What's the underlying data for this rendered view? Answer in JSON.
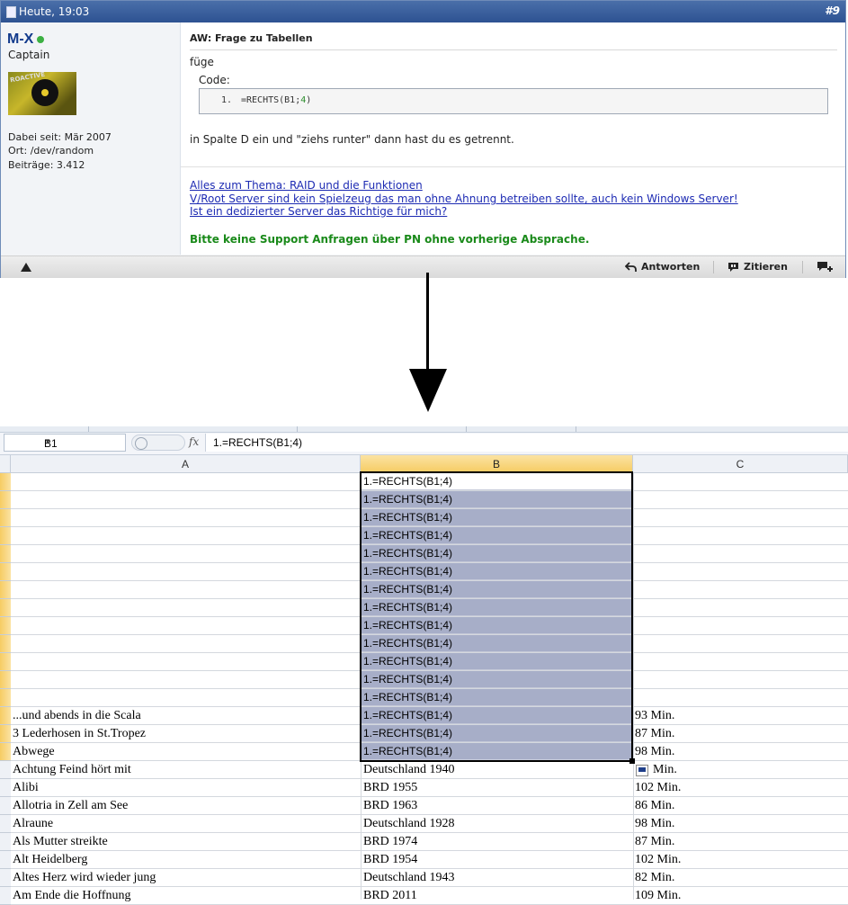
{
  "post": {
    "header": {
      "date": "Heute, 19:03",
      "number": "#9"
    },
    "user": {
      "name": "M-X",
      "rank": "Captain",
      "avatar_text": "ROACTIVE",
      "info": [
        "Dabei seit: Mär 2007",
        "Ort: /dev/random",
        "Beiträge: 3.412"
      ]
    },
    "title": "AW: Frage zu Tabellen",
    "intro": "füge",
    "code": {
      "label": "Code:",
      "line_no": "1.",
      "line_pre": "=RECHTS(B1;",
      "line_num": "4",
      "line_post": ")"
    },
    "after": "in Spalte D ein und \"ziehs runter\" dann hast du es getrennt.",
    "signature": {
      "links": [
        "Alles zum Thema: RAID und die Funktionen",
        "V/Root Server sind kein Spielzeug das man ohne Ahnung betreiben sollte, auch kein Windows Server!",
        "Ist ein dedizierter Server das Richtige für mich?"
      ],
      "note": "Bitte keine Support Anfragen über PN ohne vorherige Absprache."
    },
    "toolbar": {
      "reply": "Antworten",
      "quote": "Zitieren"
    }
  },
  "sheet": {
    "name_box": "B1",
    "fx": "fx",
    "formula": "1.=RECHTS(B1;4)",
    "columns": [
      "A",
      "B",
      "C"
    ],
    "selected_value": "1.=RECHTS(B1;4)",
    "rows": [
      {
        "a": "",
        "b": "1.=RECHTS(B1;4)",
        "c": ""
      },
      {
        "a": "",
        "b": "1.=RECHTS(B1;4)",
        "c": ""
      },
      {
        "a": "",
        "b": "1.=RECHTS(B1;4)",
        "c": ""
      },
      {
        "a": "",
        "b": "1.=RECHTS(B1;4)",
        "c": ""
      },
      {
        "a": "",
        "b": "1.=RECHTS(B1;4)",
        "c": ""
      },
      {
        "a": "",
        "b": "1.=RECHTS(B1;4)",
        "c": ""
      },
      {
        "a": "",
        "b": "1.=RECHTS(B1;4)",
        "c": ""
      },
      {
        "a": "",
        "b": "1.=RECHTS(B1;4)",
        "c": ""
      },
      {
        "a": "",
        "b": "1.=RECHTS(B1;4)",
        "c": ""
      },
      {
        "a": "",
        "b": "1.=RECHTS(B1;4)",
        "c": ""
      },
      {
        "a": "",
        "b": "1.=RECHTS(B1;4)",
        "c": ""
      },
      {
        "a": "",
        "b": "1.=RECHTS(B1;4)",
        "c": ""
      },
      {
        "a": "",
        "b": "1.=RECHTS(B1;4)",
        "c": ""
      },
      {
        "a": "...und abends in die Scala",
        "b": "1.=RECHTS(B1;4)",
        "c": "93 Min."
      },
      {
        "a": "3 Lederhosen in St.Tropez",
        "b": "1.=RECHTS(B1;4)",
        "c": "87 Min."
      },
      {
        "a": "Abwege",
        "b": "1.=RECHTS(B1;4)",
        "c": "98 Min."
      },
      {
        "a": "Achtung Feind hört mit",
        "b": "Deutschland 1940",
        "c": "Min."
      },
      {
        "a": "Alibi",
        "b": "BRD 1955",
        "c": "102 Min."
      },
      {
        "a": "Allotria in Zell am See",
        "b": "BRD 1963",
        "c": "86 Min."
      },
      {
        "a": "Alraune",
        "b": "Deutschland 1928",
        "c": "98 Min."
      },
      {
        "a": "Als Mutter streikte",
        "b": "BRD 1974",
        "c": "87 Min."
      },
      {
        "a": "Alt Heidelberg",
        "b": "BRD 1954",
        "c": "102 Min."
      },
      {
        "a": "Altes Herz wird wieder jung",
        "b": "Deutschland 1943",
        "c": "82 Min."
      },
      {
        "a": "Am Ende die Hoffnung",
        "b": "BRD 2011",
        "c": "109 Min."
      }
    ]
  }
}
